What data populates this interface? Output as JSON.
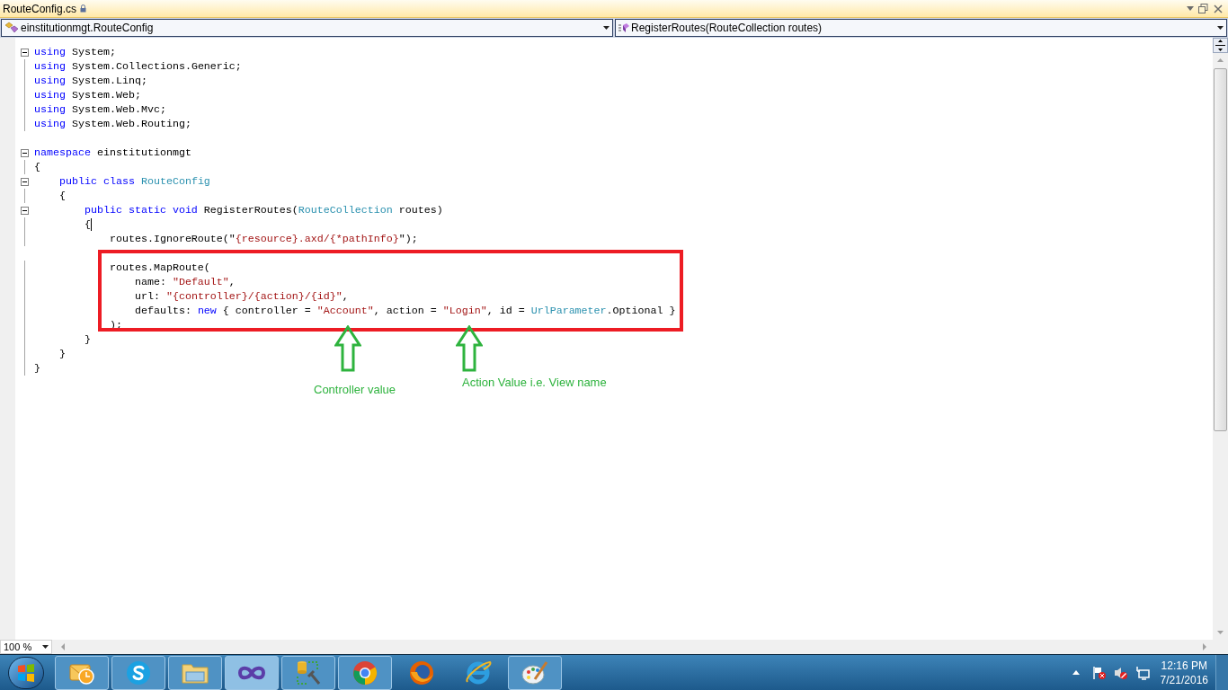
{
  "document_tab": {
    "title": "RouteConfig.cs"
  },
  "nav_bar": {
    "type_dropdown": "einstitutionmgt.RouteConfig",
    "member_dropdown": "RegisterRoutes(RouteCollection routes)"
  },
  "code_lines": [
    {
      "kind": "code",
      "foldable": true,
      "tokens": [
        {
          "kind": "keyword",
          "text": "using"
        },
        {
          "kind": "plain",
          "text": " System;"
        }
      ]
    },
    {
      "kind": "code",
      "foldable": false,
      "tokens": [
        {
          "kind": "keyword",
          "text": "using"
        },
        {
          "kind": "plain",
          "text": " System.Collections.Generic;"
        }
      ]
    },
    {
      "kind": "code",
      "foldable": false,
      "tokens": [
        {
          "kind": "keyword",
          "text": "using"
        },
        {
          "kind": "plain",
          "text": " System.Linq;"
        }
      ]
    },
    {
      "kind": "code",
      "foldable": false,
      "tokens": [
        {
          "kind": "keyword",
          "text": "using"
        },
        {
          "kind": "plain",
          "text": " System.Web;"
        }
      ]
    },
    {
      "kind": "code",
      "foldable": false,
      "tokens": [
        {
          "kind": "keyword",
          "text": "using"
        },
        {
          "kind": "plain",
          "text": " System.Web.Mvc;"
        }
      ]
    },
    {
      "kind": "code",
      "foldable": false,
      "tokens": [
        {
          "kind": "keyword",
          "text": "using"
        },
        {
          "kind": "plain",
          "text": " System.Web.Routing;"
        }
      ]
    },
    {
      "kind": "blank"
    },
    {
      "kind": "code",
      "foldable": true,
      "tokens": [
        {
          "kind": "keyword",
          "text": "namespace"
        },
        {
          "kind": "plain",
          "text": " einstitutionmgt"
        }
      ]
    },
    {
      "kind": "code",
      "foldable": false,
      "tokens": [
        {
          "kind": "plain",
          "text": "{"
        }
      ]
    },
    {
      "kind": "code",
      "foldable": true,
      "tokens": [
        {
          "kind": "keyword",
          "text": "    public class "
        },
        {
          "kind": "type",
          "text": "RouteConfig"
        }
      ]
    },
    {
      "kind": "code",
      "foldable": false,
      "tokens": [
        {
          "kind": "plain",
          "text": "    {"
        }
      ]
    },
    {
      "kind": "code",
      "foldable": true,
      "tokens": [
        {
          "kind": "keyword",
          "text": "        public static void"
        },
        {
          "kind": "plain",
          "text": " RegisterRoutes("
        },
        {
          "kind": "type",
          "text": "RouteCollection"
        },
        {
          "kind": "plain",
          "text": " routes)"
        }
      ]
    },
    {
      "kind": "code",
      "foldable": false,
      "cursor": true,
      "tokens": [
        {
          "kind": "plain",
          "text": "        {"
        }
      ]
    },
    {
      "kind": "code",
      "foldable": false,
      "tokens": [
        {
          "kind": "plain",
          "text": "            routes.IgnoreRoute(\""
        },
        {
          "kind": "string",
          "text": "{resource}.axd/{*pathInfo}"
        },
        {
          "kind": "plain",
          "text": "\");"
        }
      ]
    },
    {
      "kind": "blank"
    },
    {
      "kind": "code",
      "foldable": false,
      "tokens": [
        {
          "kind": "plain",
          "text": "            routes.MapRoute("
        }
      ]
    },
    {
      "kind": "code",
      "foldable": false,
      "tokens": [
        {
          "kind": "plain",
          "text": "                name: "
        },
        {
          "kind": "string",
          "text": "\"Default\""
        },
        {
          "kind": "plain",
          "text": ","
        }
      ]
    },
    {
      "kind": "code",
      "foldable": false,
      "tokens": [
        {
          "kind": "plain",
          "text": "                url: "
        },
        {
          "kind": "string",
          "text": "\"{controller}/{action}/{id}\""
        },
        {
          "kind": "plain",
          "text": ","
        }
      ]
    },
    {
      "kind": "code",
      "foldable": false,
      "tokens": [
        {
          "kind": "plain",
          "text": "                defaults: "
        },
        {
          "kind": "keyword",
          "text": "new"
        },
        {
          "kind": "plain",
          "text": " { controller = "
        },
        {
          "kind": "string",
          "text": "\"Account\""
        },
        {
          "kind": "plain",
          "text": ", action = "
        },
        {
          "kind": "string",
          "text": "\"Login\""
        },
        {
          "kind": "plain",
          "text": ", id = "
        },
        {
          "kind": "type",
          "text": "UrlParameter"
        },
        {
          "kind": "plain",
          "text": ".Optional }"
        }
      ]
    },
    {
      "kind": "code",
      "foldable": false,
      "tokens": [
        {
          "kind": "plain",
          "text": "            );"
        }
      ]
    },
    {
      "kind": "code",
      "foldable": false,
      "tokens": [
        {
          "kind": "plain",
          "text": "        }"
        }
      ]
    },
    {
      "kind": "code",
      "foldable": false,
      "tokens": [
        {
          "kind": "plain",
          "text": "    }"
        }
      ]
    },
    {
      "kind": "code",
      "foldable": false,
      "tokens": [
        {
          "kind": "plain",
          "text": "}"
        }
      ]
    }
  ],
  "annotations": [
    {
      "label": "Controller value"
    },
    {
      "label": "Action Value i.e. View name"
    }
  ],
  "zoom": "100 %",
  "taskbar": {
    "apps": [
      {
        "kind": "outlook",
        "running": true,
        "selected": false
      },
      {
        "kind": "skype",
        "running": true,
        "selected": false
      },
      {
        "kind": "explorer",
        "running": true,
        "selected": false
      },
      {
        "kind": "visualstudio",
        "running": true,
        "selected": true
      },
      {
        "kind": "dbtool",
        "running": true,
        "selected": false
      },
      {
        "kind": "chrome",
        "running": true,
        "selected": false
      },
      {
        "kind": "firefox",
        "running": false,
        "selected": false
      },
      {
        "kind": "ie",
        "running": false,
        "selected": false
      },
      {
        "kind": "paint",
        "running": true,
        "selected": false
      }
    ],
    "time": "12:16 PM",
    "date": "7/21/2016"
  }
}
